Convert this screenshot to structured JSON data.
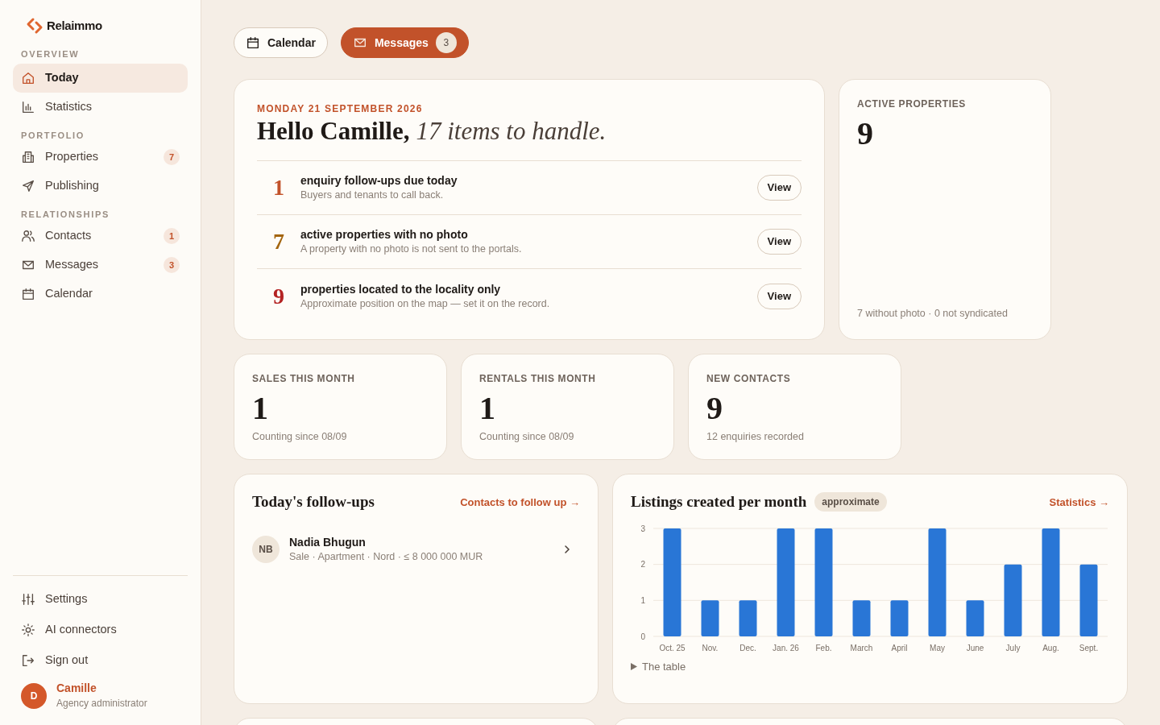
{
  "brand": {
    "name": "Relaimmo"
  },
  "sidebar": {
    "sections": [
      {
        "title": "OVERVIEW",
        "items": [
          {
            "label": "Today",
            "selected": true
          },
          {
            "label": "Statistics",
            "selected": false
          }
        ]
      },
      {
        "title": "PORTFOLIO",
        "items": [
          {
            "label": "Properties",
            "selected": false,
            "badge": "7"
          },
          {
            "label": "Publishing",
            "selected": false
          }
        ]
      },
      {
        "title": "RELATIONSHIPS",
        "items": [
          {
            "label": "Contacts",
            "selected": false,
            "badge": "1"
          },
          {
            "label": "Messages",
            "selected": false,
            "badge": "3"
          },
          {
            "label": "Calendar",
            "selected": false
          }
        ]
      }
    ],
    "footer_items": [
      {
        "label": "Settings"
      },
      {
        "label": "AI connectors"
      },
      {
        "label": "Sign out"
      }
    ],
    "user": {
      "initial": "D",
      "name": "Camille",
      "role": "Agency administrator"
    }
  },
  "top_buttons": [
    {
      "label": "Calendar",
      "selected": false
    },
    {
      "label": "Messages",
      "selected": true,
      "count": "3"
    }
  ],
  "today": {
    "date": "MONDAY 21 SEPTEMBER 2026",
    "greeting": "Hello Camille,",
    "summary": "17 items to handle.",
    "tasks": [
      {
        "count": "1",
        "color": "#c2522a",
        "title": "enquiry follow-ups due today",
        "subtitle": "Buyers and tenants to call back.",
        "action": "View"
      },
      {
        "count": "7",
        "color": "#a3650f",
        "title": "active properties with no photo",
        "subtitle": "A property with no photo is not sent to the portals.",
        "action": "View"
      },
      {
        "count": "9",
        "color": "#b42323",
        "title": "properties located to the locality only",
        "subtitle": "Approximate position on the map — set it on the record.",
        "action": "View"
      }
    ]
  },
  "active_properties": {
    "label": "ACTIVE PROPERTIES",
    "value": "9",
    "note": "7 without photo · 0 not syndicated"
  },
  "stats": [
    {
      "label": "SALES THIS MONTH",
      "value": "1",
      "note": "Counting since 08/09"
    },
    {
      "label": "RENTALS THIS MONTH",
      "value": "1",
      "note": "Counting since 08/09"
    },
    {
      "label": "NEW CONTACTS",
      "value": "9",
      "note": "12 enquiries recorded"
    }
  ],
  "follow_ups": {
    "title": "Today's follow-ups",
    "link": "Contacts to follow up →",
    "contacts": [
      {
        "initials": "NB",
        "name": "Nadia Bhugun",
        "details": "Sale · Apartment · Nord · ≤ 8 000 000 MUR"
      }
    ]
  },
  "listings": {
    "title": "Listings created per month",
    "badge": "approximate",
    "link": "Statistics →",
    "table_toggle": "The table",
    "chart_data": {
      "type": "bar",
      "categories": [
        "Oct. 25",
        "Nov.",
        "Dec.",
        "Jan. 26",
        "Feb.",
        "March",
        "April",
        "May",
        "June",
        "July",
        "Aug.",
        "Sept."
      ],
      "series": [
        {
          "color": "#2976d6",
          "values": [
            3,
            1,
            1,
            3,
            3,
            1,
            1,
            3,
            1,
            2,
            3,
            2
          ]
        }
      ],
      "ylim": [
        0,
        3
      ],
      "yticks": [
        0,
        1,
        2,
        3
      ]
    }
  }
}
